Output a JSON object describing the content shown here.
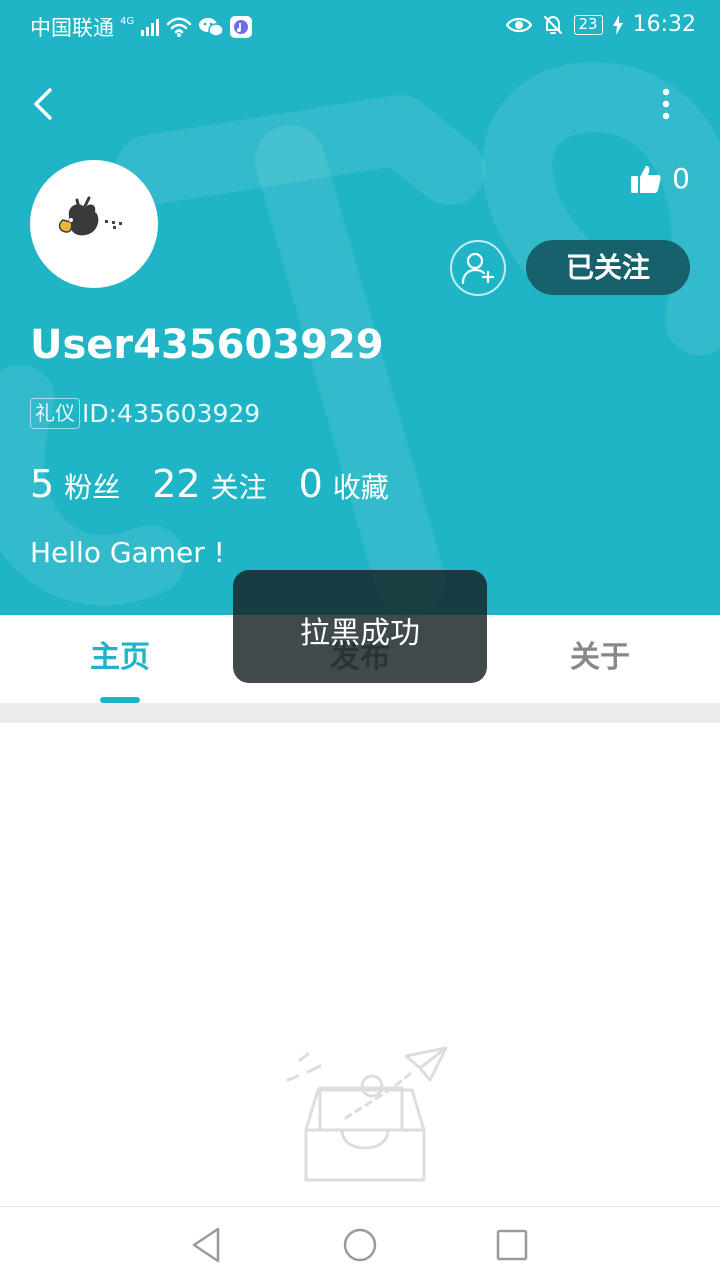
{
  "status_bar": {
    "carrier": "中国联通",
    "network": "4G",
    "battery": "23",
    "time": "16:32"
  },
  "profile": {
    "likes": "0",
    "follow_button": "已关注",
    "username": "User435603929",
    "id_tag": "礼仪",
    "id_text": "ID:435603929",
    "stats": [
      {
        "value": "5",
        "label": "粉丝"
      },
      {
        "value": "22",
        "label": "关注"
      },
      {
        "value": "0",
        "label": "收藏"
      }
    ],
    "bio": "Hello Gamer !"
  },
  "tabs": [
    {
      "label": "主页",
      "active": true
    },
    {
      "label": "发布",
      "active": false
    },
    {
      "label": "关于",
      "active": false
    }
  ],
  "toast": {
    "message": "拉黑成功"
  },
  "colors": {
    "brand": "#1fb5c7",
    "follow_button": "#17616d",
    "tab_inactive": "#888888"
  },
  "icons": [
    "back-arrow-icon",
    "more-vertical-icon",
    "thumbs-up-icon",
    "add-user-icon",
    "empty-inbox-icon",
    "nav-back-icon",
    "nav-home-icon",
    "nav-recents-icon"
  ]
}
